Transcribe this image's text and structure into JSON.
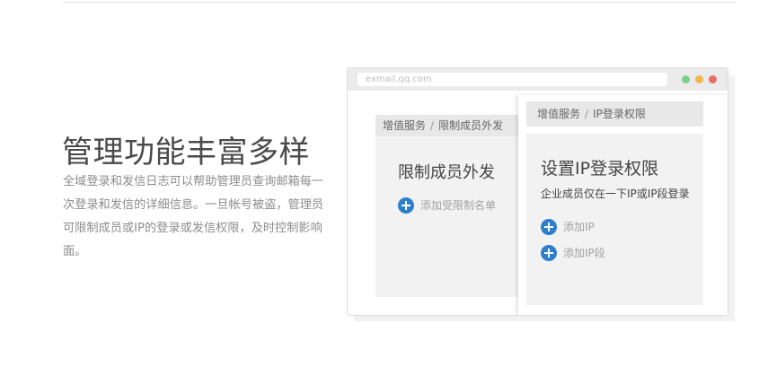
{
  "headline": "管理功能丰富多样",
  "description": "全域登录和发信日志可以帮助管理员查询邮箱每一次登录和发信的详细信息。一旦帐号被盗，管理员可限制成员或IP的登录或发信权限，及时控制影响面。",
  "browser": {
    "address": "exmail.qq.com",
    "back_panel": {
      "breadcrumb": [
        "增值服务",
        "限制成员外发"
      ],
      "title": "限制成员外发",
      "add_label": "添加受限制名单"
    },
    "front_panel": {
      "breadcrumb": [
        "增值服务",
        "IP登录权限"
      ],
      "title": "设置IP登录权限",
      "subtitle": "企业成员仅在一下IP或IP段登录",
      "add_ip_label": "添加IP",
      "add_ip_range_label": "添加IP段"
    },
    "separator": "/",
    "icons": {
      "add": "plus-circle-icon"
    },
    "colors": {
      "accent": "#2e7ed0",
      "dot_green": "#7ccf8f",
      "dot_yellow": "#f0b74a",
      "dot_red": "#e77066"
    }
  }
}
